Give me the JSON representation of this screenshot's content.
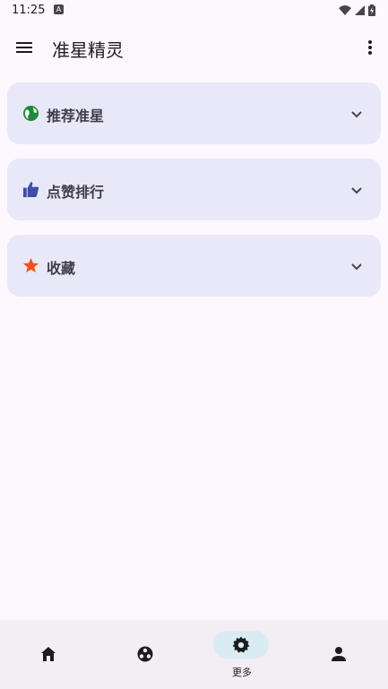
{
  "status_bar": {
    "time": "11:25",
    "notification_icon": "A"
  },
  "app_bar": {
    "title": "准星精灵",
    "menu_icon": "menu-icon",
    "overflow_icon": "more-vert-icon"
  },
  "sections": [
    {
      "label": "推荐准星",
      "icon": "globe-icon",
      "color": "#1c8a3a"
    },
    {
      "label": "点赞排行",
      "icon": "thumb-up-icon",
      "color": "#3e4fa8"
    },
    {
      "label": "收藏",
      "icon": "star-icon",
      "color": "#f4511e"
    }
  ],
  "bottom_nav": {
    "items": [
      {
        "icon": "home-icon",
        "label": ""
      },
      {
        "icon": "crosshair-icon",
        "label": ""
      },
      {
        "icon": "gear-icon",
        "label": "更多",
        "active": true
      },
      {
        "icon": "person-icon",
        "label": ""
      }
    ]
  }
}
